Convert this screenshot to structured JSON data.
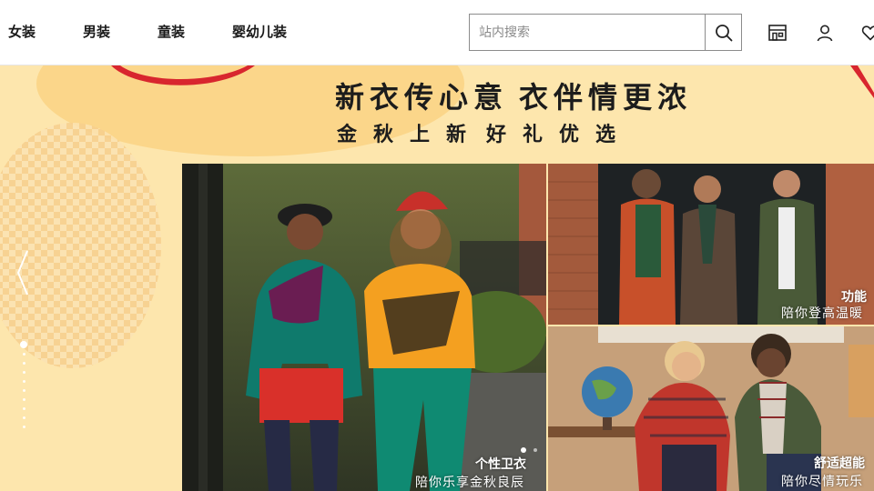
{
  "nav": {
    "items": [
      {
        "label": "女装"
      },
      {
        "label": "男装"
      },
      {
        "label": "童装"
      },
      {
        "label": "婴幼儿装"
      }
    ]
  },
  "search": {
    "placeholder": "站内搜索",
    "value": ""
  },
  "header_icons": [
    "search-icon",
    "store-icon",
    "user-icon",
    "heart-icon"
  ],
  "banner": {
    "headline_a": "新衣传心意",
    "headline_b": "衣伴情更浓",
    "sub_a": "金秋上新",
    "sub_b": "好礼优选",
    "carousel_count": 10,
    "carousel_active": 1
  },
  "panels": {
    "main": {
      "title": "个性卫衣",
      "subtitle": "陪你乐享金秋良辰"
    },
    "top": {
      "title": "功能",
      "subtitle": "陪你登高温暖"
    },
    "bottom": {
      "title": "舒适超能",
      "subtitle": "陪你尽情玩乐"
    }
  },
  "colors": {
    "banner_bg": "#fde6ad",
    "blob": "#fbd68a",
    "ribbon": "#d8262e",
    "text_dark": "#1c1c1c"
  }
}
